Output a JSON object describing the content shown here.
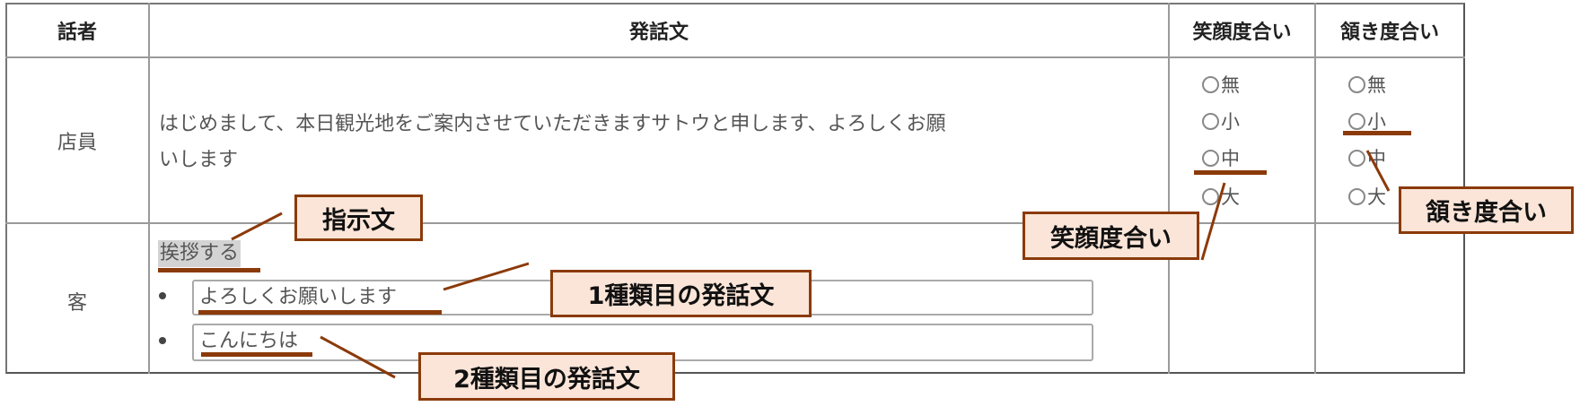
{
  "table": {
    "headers": [
      "話者",
      "発話文",
      "笑顔度合い",
      "頷き度合い"
    ],
    "rows": [
      {
        "speaker": "店員",
        "utterance_line1": "はじめまして、本日観光地をご案内させていただきますサトウと申します、よろしくお願",
        "utterance_line2": "いします",
        "smile_options": [
          "無",
          "小",
          "中",
          "大"
        ],
        "smile_selected": "中",
        "nod_options": [
          "無",
          "小",
          "中",
          "大"
        ],
        "nod_selected": "小"
      },
      {
        "speaker": "客",
        "instruction": "挨拶する",
        "utterance_inputs": [
          "よろしくお願いします",
          "こんにちは"
        ]
      }
    ]
  },
  "annotations": {
    "instruction": "指示文",
    "first_utterance": "1種類目の発話文",
    "second_utterance": "2種類目の発話文",
    "smile": "笑顔度合い",
    "nod": "頷き度合い"
  },
  "colors": {
    "annotation_border": "#8b3a0a",
    "annotation_fill": "#fbe5d8",
    "instruction_bg": "#d3d3d3"
  }
}
